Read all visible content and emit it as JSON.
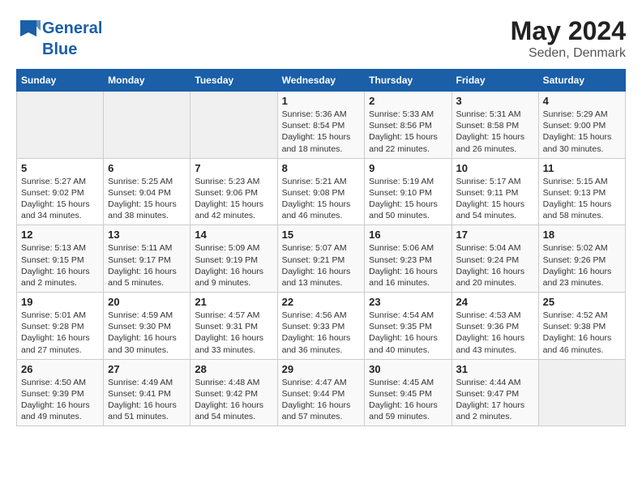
{
  "header": {
    "logo_line1": "General",
    "logo_line2": "Blue",
    "month": "May 2024",
    "location": "Seden, Denmark"
  },
  "days_of_week": [
    "Sunday",
    "Monday",
    "Tuesday",
    "Wednesday",
    "Thursday",
    "Friday",
    "Saturday"
  ],
  "weeks": [
    [
      {
        "day": "",
        "info": ""
      },
      {
        "day": "",
        "info": ""
      },
      {
        "day": "",
        "info": ""
      },
      {
        "day": "1",
        "info": "Sunrise: 5:36 AM\nSunset: 8:54 PM\nDaylight: 15 hours\nand 18 minutes."
      },
      {
        "day": "2",
        "info": "Sunrise: 5:33 AM\nSunset: 8:56 PM\nDaylight: 15 hours\nand 22 minutes."
      },
      {
        "day": "3",
        "info": "Sunrise: 5:31 AM\nSunset: 8:58 PM\nDaylight: 15 hours\nand 26 minutes."
      },
      {
        "day": "4",
        "info": "Sunrise: 5:29 AM\nSunset: 9:00 PM\nDaylight: 15 hours\nand 30 minutes."
      }
    ],
    [
      {
        "day": "5",
        "info": "Sunrise: 5:27 AM\nSunset: 9:02 PM\nDaylight: 15 hours\nand 34 minutes."
      },
      {
        "day": "6",
        "info": "Sunrise: 5:25 AM\nSunset: 9:04 PM\nDaylight: 15 hours\nand 38 minutes."
      },
      {
        "day": "7",
        "info": "Sunrise: 5:23 AM\nSunset: 9:06 PM\nDaylight: 15 hours\nand 42 minutes."
      },
      {
        "day": "8",
        "info": "Sunrise: 5:21 AM\nSunset: 9:08 PM\nDaylight: 15 hours\nand 46 minutes."
      },
      {
        "day": "9",
        "info": "Sunrise: 5:19 AM\nSunset: 9:10 PM\nDaylight: 15 hours\nand 50 minutes."
      },
      {
        "day": "10",
        "info": "Sunrise: 5:17 AM\nSunset: 9:11 PM\nDaylight: 15 hours\nand 54 minutes."
      },
      {
        "day": "11",
        "info": "Sunrise: 5:15 AM\nSunset: 9:13 PM\nDaylight: 15 hours\nand 58 minutes."
      }
    ],
    [
      {
        "day": "12",
        "info": "Sunrise: 5:13 AM\nSunset: 9:15 PM\nDaylight: 16 hours\nand 2 minutes."
      },
      {
        "day": "13",
        "info": "Sunrise: 5:11 AM\nSunset: 9:17 PM\nDaylight: 16 hours\nand 5 minutes."
      },
      {
        "day": "14",
        "info": "Sunrise: 5:09 AM\nSunset: 9:19 PM\nDaylight: 16 hours\nand 9 minutes."
      },
      {
        "day": "15",
        "info": "Sunrise: 5:07 AM\nSunset: 9:21 PM\nDaylight: 16 hours\nand 13 minutes."
      },
      {
        "day": "16",
        "info": "Sunrise: 5:06 AM\nSunset: 9:23 PM\nDaylight: 16 hours\nand 16 minutes."
      },
      {
        "day": "17",
        "info": "Sunrise: 5:04 AM\nSunset: 9:24 PM\nDaylight: 16 hours\nand 20 minutes."
      },
      {
        "day": "18",
        "info": "Sunrise: 5:02 AM\nSunset: 9:26 PM\nDaylight: 16 hours\nand 23 minutes."
      }
    ],
    [
      {
        "day": "19",
        "info": "Sunrise: 5:01 AM\nSunset: 9:28 PM\nDaylight: 16 hours\nand 27 minutes."
      },
      {
        "day": "20",
        "info": "Sunrise: 4:59 AM\nSunset: 9:30 PM\nDaylight: 16 hours\nand 30 minutes."
      },
      {
        "day": "21",
        "info": "Sunrise: 4:57 AM\nSunset: 9:31 PM\nDaylight: 16 hours\nand 33 minutes."
      },
      {
        "day": "22",
        "info": "Sunrise: 4:56 AM\nSunset: 9:33 PM\nDaylight: 16 hours\nand 36 minutes."
      },
      {
        "day": "23",
        "info": "Sunrise: 4:54 AM\nSunset: 9:35 PM\nDaylight: 16 hours\nand 40 minutes."
      },
      {
        "day": "24",
        "info": "Sunrise: 4:53 AM\nSunset: 9:36 PM\nDaylight: 16 hours\nand 43 minutes."
      },
      {
        "day": "25",
        "info": "Sunrise: 4:52 AM\nSunset: 9:38 PM\nDaylight: 16 hours\nand 46 minutes."
      }
    ],
    [
      {
        "day": "26",
        "info": "Sunrise: 4:50 AM\nSunset: 9:39 PM\nDaylight: 16 hours\nand 49 minutes."
      },
      {
        "day": "27",
        "info": "Sunrise: 4:49 AM\nSunset: 9:41 PM\nDaylight: 16 hours\nand 51 minutes."
      },
      {
        "day": "28",
        "info": "Sunrise: 4:48 AM\nSunset: 9:42 PM\nDaylight: 16 hours\nand 54 minutes."
      },
      {
        "day": "29",
        "info": "Sunrise: 4:47 AM\nSunset: 9:44 PM\nDaylight: 16 hours\nand 57 minutes."
      },
      {
        "day": "30",
        "info": "Sunrise: 4:45 AM\nSunset: 9:45 PM\nDaylight: 16 hours\nand 59 minutes."
      },
      {
        "day": "31",
        "info": "Sunrise: 4:44 AM\nSunset: 9:47 PM\nDaylight: 17 hours\nand 2 minutes."
      },
      {
        "day": "",
        "info": ""
      }
    ]
  ]
}
